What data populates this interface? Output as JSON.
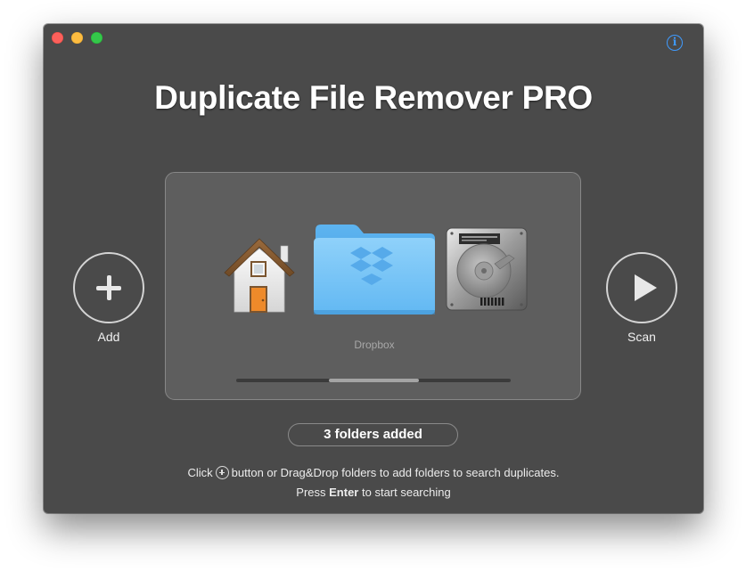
{
  "window": {
    "title": "Duplicate File Remover PRO",
    "colors": {
      "background": "#4a4a4a",
      "accent": "#3f9bff"
    }
  },
  "toolbar": {
    "info_icon": "info-icon",
    "info_glyph": "i"
  },
  "actions": {
    "add_label": "Add",
    "add_icon": "plus-icon",
    "scan_label": "Scan",
    "scan_icon": "play-icon"
  },
  "folders": {
    "items": [
      {
        "icon": "home-folder-icon",
        "label": ""
      },
      {
        "icon": "dropbox-folder-icon",
        "label": "Dropbox"
      },
      {
        "icon": "hard-drive-icon",
        "label": ""
      }
    ],
    "selected_label": "Dropbox"
  },
  "status": {
    "count_text": "3 folders added"
  },
  "hints": {
    "line1_prefix": "Click",
    "line1_suffix": "button or Drag&Drop folders to add folders to search duplicates.",
    "line2_prefix": "Press",
    "line2_key": "Enter",
    "line2_suffix": "to start searching"
  }
}
